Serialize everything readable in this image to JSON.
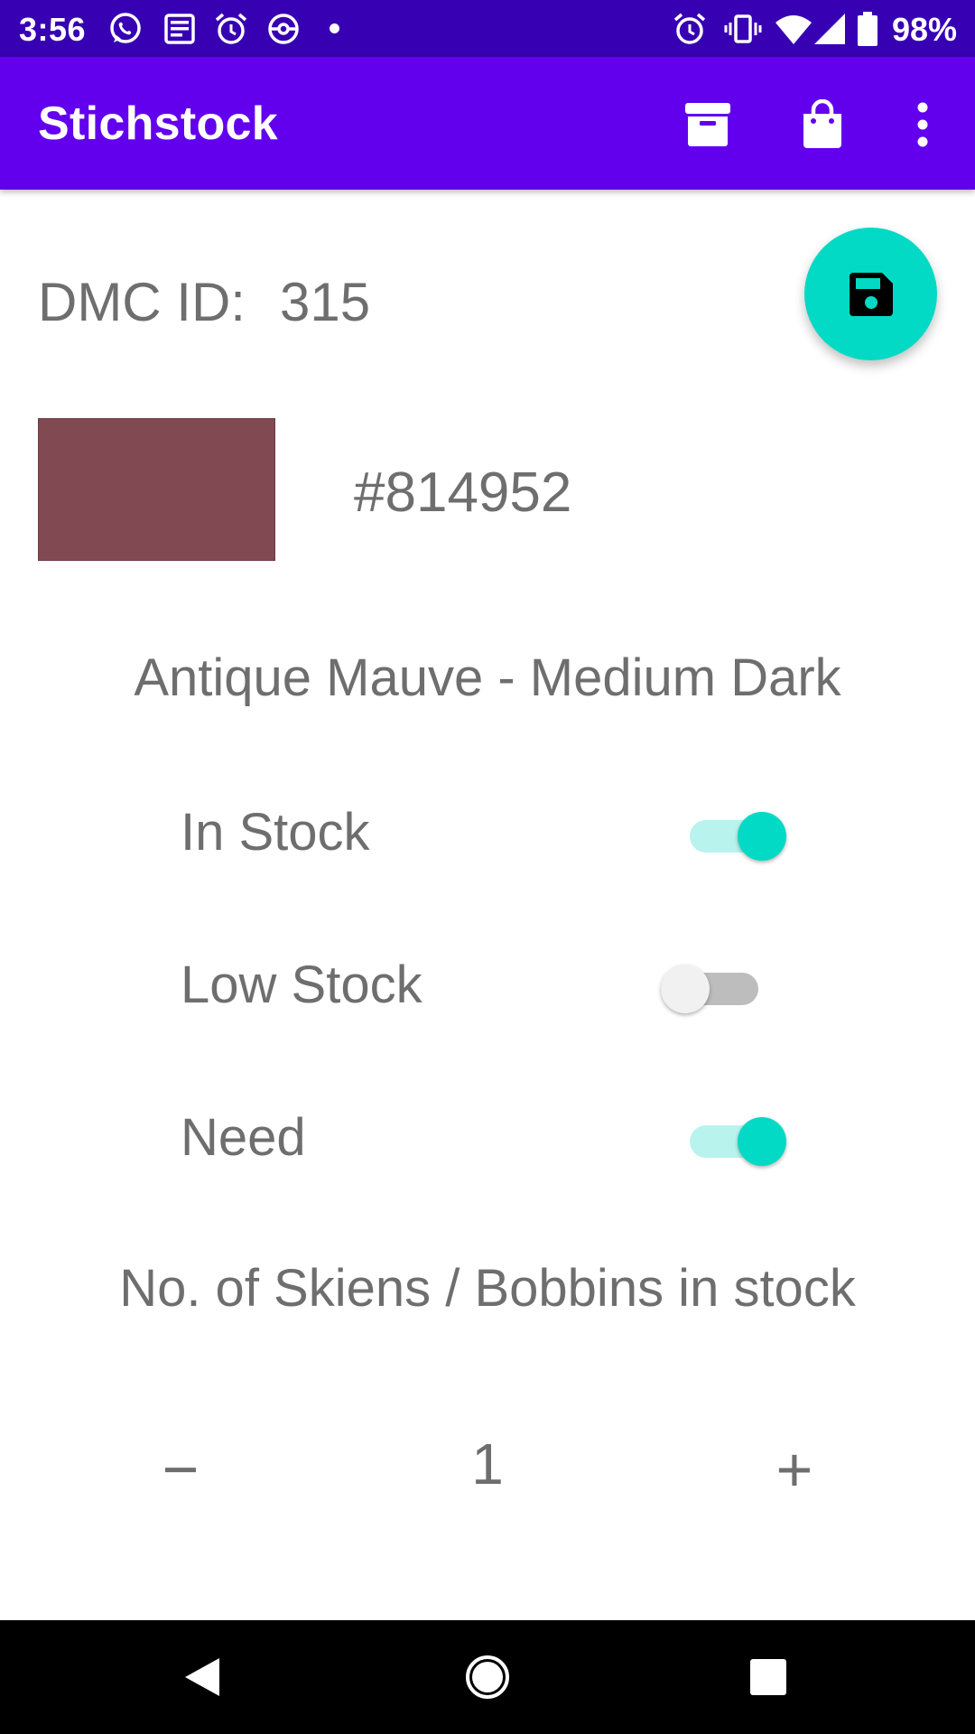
{
  "status_bar": {
    "time": "3:56",
    "battery_text": "98%",
    "left_icons": [
      "whatsapp-icon",
      "news-icon",
      "alarm-icon",
      "pokeball-icon",
      "notification-dot"
    ],
    "right_icons": [
      "alarm-icon",
      "vibrate-icon",
      "wifi-icon",
      "signal-icon",
      "battery-icon"
    ]
  },
  "app_bar": {
    "title": "Stichstock",
    "actions": [
      "archive-icon",
      "shopping-bag-icon",
      "more-vert-icon"
    ]
  },
  "detail": {
    "dmc_label": "DMC ID:",
    "dmc_value": "315",
    "swatch_color": "#814952",
    "hex_text": "#814952",
    "color_name": "Antique Mauve - Medium Dark"
  },
  "toggles": [
    {
      "label": "In Stock",
      "on": true
    },
    {
      "label": "Low Stock",
      "on": false
    },
    {
      "label": "Need",
      "on": true
    }
  ],
  "skeins": {
    "label": "No. of Skiens / Bobbins in stock",
    "minus": "−",
    "value": "1",
    "plus": "+"
  },
  "fab": {
    "icon": "save-icon"
  },
  "colors": {
    "status_bar": "#3700b3",
    "app_bar": "#6200ee",
    "accent": "#03dac5",
    "text": "#6e6e6e"
  },
  "nav_bar": {
    "buttons": [
      "back-icon",
      "home-icon",
      "recents-icon"
    ]
  }
}
